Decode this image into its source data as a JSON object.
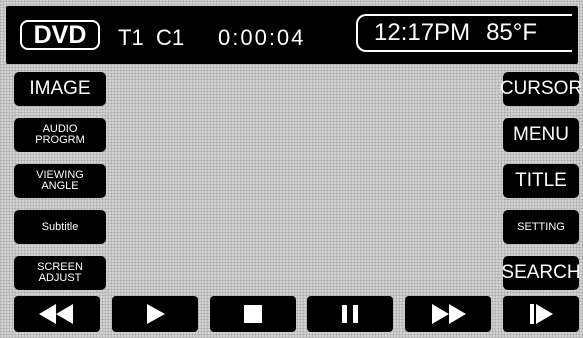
{
  "status_bar": {
    "source_label": "DVD",
    "title_num": "T1",
    "chapter_num": "C1",
    "elapsed": "0:00:04",
    "clock": "12:17PM",
    "temperature": "85°F"
  },
  "left_menu": [
    {
      "label": "IMAGE"
    },
    {
      "label_line1": "AUDIO",
      "label_line2": "PROGRM"
    },
    {
      "label_line1": "VIEWING",
      "label_line2": "ANGLE"
    },
    {
      "label": "Subtitle"
    },
    {
      "label_line1": "SCREEN",
      "label_line2": "ADJUST"
    }
  ],
  "right_menu": [
    {
      "label": "CURSOR"
    },
    {
      "label": "MENU"
    },
    {
      "label": "TITLE"
    },
    {
      "label": "SETTING"
    },
    {
      "label": "SEARCH"
    }
  ],
  "transport": [
    {
      "icon": "rewind-icon"
    },
    {
      "icon": "play-icon"
    },
    {
      "icon": "stop-icon"
    },
    {
      "icon": "pause-icon"
    },
    {
      "icon": "fast-forward-icon"
    },
    {
      "icon": "next-chapter-icon"
    }
  ],
  "colors": {
    "button_bg": "#000000",
    "button_text": "#ffffff",
    "screen_bg": "#d2d2d2"
  }
}
